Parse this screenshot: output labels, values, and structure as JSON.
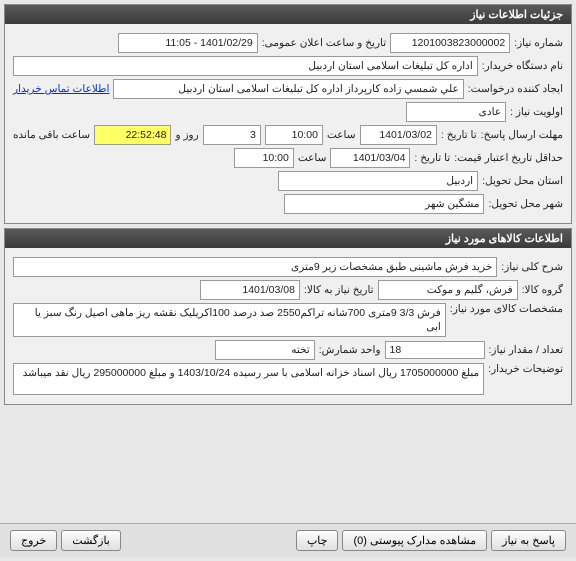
{
  "panel1": {
    "title": "جزئیات اطلاعات نیاز",
    "need_number_label": "شماره نیاز:",
    "need_number": "1201003823000002",
    "announce_label": "تاریخ و ساعت اعلان عمومی:",
    "announce_value": "1401/02/29 - 11:05",
    "buyer_org_label": "نام دستگاه خریدار:",
    "buyer_org": "اداره کل تبلیغات اسلامی استان اردبیل",
    "requester_label": "ایجاد کننده درخواست:",
    "requester": "علي شمسي زاده کارپرداز اداره کل تبلیغات اسلامی استان اردبیل",
    "contact_link": "اطلاعات تماس خریدار",
    "priority_label": "اولویت نیاز :",
    "priority": "عادی",
    "deadline_label": "مهلت ارسال پاسخ:",
    "to_date_label": "تا تاریخ :",
    "deadline_date": "1401/03/02",
    "time_label": "ساعت",
    "deadline_time": "10:00",
    "days_remain": "3",
    "days_remain_label": "روز و",
    "time_remain": "22:52:48",
    "time_remain_label": "ساعت باقی مانده",
    "validity_label": "حداقل تاریخ اعتبار قیمت:",
    "validity_date": "1401/03/04",
    "validity_time": "10:00",
    "province_label": "استان محل تحویل:",
    "province": "اردبیل",
    "city_label": "شهر محل تحویل:",
    "city": "مشگین شهر"
  },
  "panel2": {
    "title": "اطلاعات کالاهای مورد نیاز",
    "desc_label": "شرح کلی نیاز:",
    "desc": "خرید فرش ماشینی طبق مشخصات زیر 9متری",
    "group_label": "گروه کالا:",
    "group": "فرش، گلیم و موکت",
    "need_date_label": "تاریخ نیاز به کالا:",
    "need_date": "1401/03/08",
    "spec_label": "مشخصات کالای مورد نیاز:",
    "spec": "فرش 3/3 9متری 700شانه تراکم2550  صد درصد 100اکریلیک نقشه  ریز ماهی اصیل رنگ سبز یا ابی",
    "qty_label": "تعداد / مقدار نیاز:",
    "qty": "18",
    "unit_label": "واحد شمارش:",
    "unit": "تخته",
    "notes_label": "توضیحات خریدار:",
    "notes": "مبلغ 1705000000 ریال اسناد خزانه اسلامی با سر رسیده 1403/10/24 و مبلغ 295000000 ریال نقد میباشد"
  },
  "buttons": {
    "reply": "پاسخ به نیاز",
    "attachments": "مشاهده مدارک پیوستی (0)",
    "print": "چاپ",
    "back": "بازگشت",
    "exit": "خروج"
  }
}
